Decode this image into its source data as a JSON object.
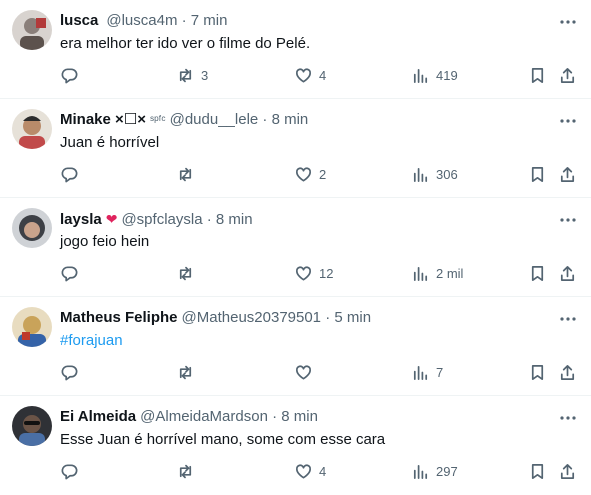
{
  "tweets": [
    {
      "name": "lusca",
      "badge": "",
      "handle": "@lusca4m",
      "separator": "·",
      "time": "7 min",
      "text": "era melhor ter ido ver o filme do Pelé.",
      "replies": "",
      "retweets": "3",
      "likes": "4",
      "views": "419",
      "avatar_color": "#8a7f7a"
    },
    {
      "name": "Minake ×☐×",
      "badge": "ˢᵖᶠᶜ",
      "handle": "@dudu__lele",
      "separator": "·",
      "time": "8 min",
      "text": "Juan é horrível",
      "replies": "",
      "retweets": "",
      "likes": "2",
      "views": "306",
      "avatar_color": "#c14a4a"
    },
    {
      "name": "laysla",
      "badge": "❤",
      "handle": "@spfclaysla",
      "separator": "·",
      "time": "8 min",
      "text": "jogo feio hein",
      "replies": "",
      "retweets": "",
      "likes": "12",
      "views": "2 mil",
      "avatar_color": "#5b5f66"
    },
    {
      "name": "Matheus Feliphe",
      "badge": "",
      "handle": "@Matheus20379501",
      "separator": "·",
      "time": "5 min",
      "text": "#forajuan",
      "replies": "",
      "retweets": "",
      "likes": "",
      "views": "7",
      "avatar_color": "#c9a35a"
    },
    {
      "name": "Ei Almeida",
      "badge": "",
      "handle": "@AlmeidaMardson",
      "separator": "·",
      "time": "8 min",
      "text": "Esse Juan é horrível mano, some com esse cara",
      "replies": "",
      "retweets": "",
      "likes": "4",
      "views": "297",
      "avatar_color": "#2f3136"
    }
  ],
  "colors": {
    "text": "#0f1419",
    "muted": "#536471",
    "link": "#1d9bf0",
    "divider": "#eff3f4",
    "heart_badge": "#e0245e"
  },
  "icons": [
    "reply-icon",
    "retweet-icon",
    "like-icon",
    "views-icon",
    "bookmark-icon",
    "share-icon",
    "more-icon"
  ]
}
